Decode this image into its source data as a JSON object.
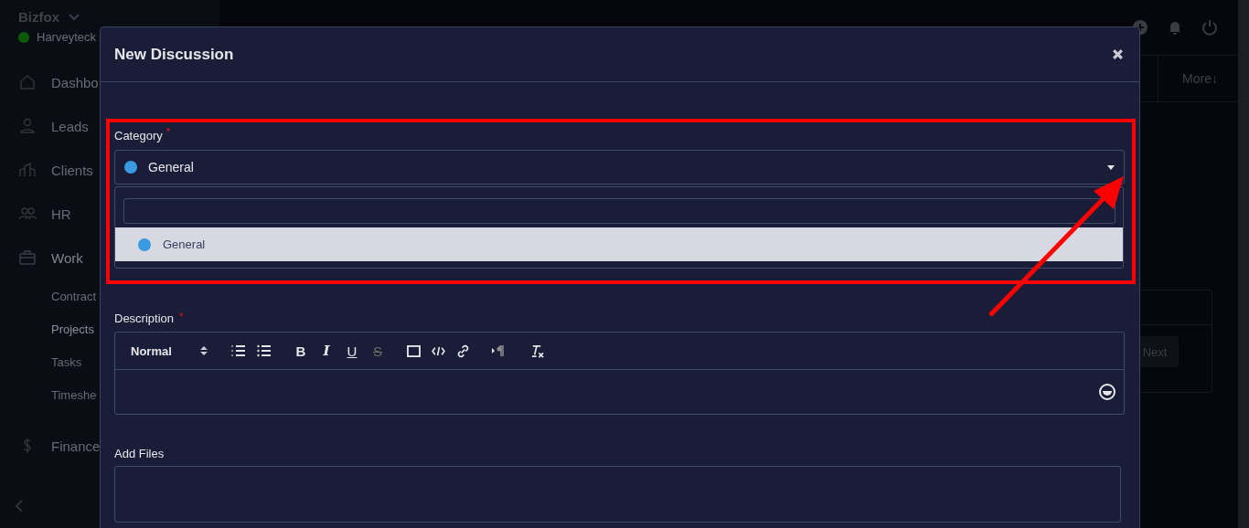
{
  "sidebar": {
    "brand": "Bizfox",
    "user": {
      "name": "Harveyteck",
      "online": true
    },
    "items": [
      {
        "label": "Dashbo",
        "bold": false
      },
      {
        "label": "Leads",
        "bold": false
      },
      {
        "label": "Clients",
        "bold": false
      },
      {
        "label": "HR",
        "bold": false
      },
      {
        "label": "Work",
        "bold": true,
        "children": [
          {
            "label": "Contract",
            "selected": false
          },
          {
            "label": "Projects",
            "selected": true
          },
          {
            "label": "Tasks",
            "selected": false
          },
          {
            "label": "Timeshe",
            "selected": false
          }
        ]
      },
      {
        "label": "Finance",
        "bold": false
      }
    ]
  },
  "background": {
    "more_button": "More↓",
    "next_button": "Next"
  },
  "modal": {
    "title": "New Discussion",
    "category": {
      "label": "Category",
      "required_mark": "*",
      "value": {
        "label": "General",
        "color": "#3a9be2"
      },
      "open": true,
      "options": [
        {
          "label": "General",
          "color": "#3a9be2",
          "selected": true
        }
      ]
    },
    "description": {
      "label": "Description",
      "required_mark": "*",
      "style_select": "Normal",
      "marks": [
        {
          "label": "B",
          "disabled": false
        },
        {
          "label": "I",
          "disabled": false
        },
        {
          "label": "U",
          "disabled": false
        },
        {
          "label": "S",
          "disabled": true
        }
      ]
    },
    "files": {
      "label": "Add Files"
    }
  }
}
